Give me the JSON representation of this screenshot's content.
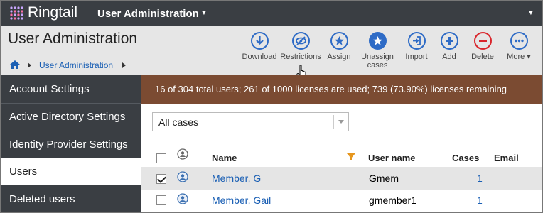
{
  "app": {
    "brand": "Ringtail",
    "module": "User Administration"
  },
  "header": {
    "title": "User Administration",
    "breadcrumb": [
      "User Administration"
    ]
  },
  "toolbar": [
    {
      "label": "Download",
      "icon": "download-icon"
    },
    {
      "label": "Restrictions",
      "icon": "eye-slash-icon"
    },
    {
      "label": "Assign",
      "icon": "star-icon"
    },
    {
      "label": "Unassign cases",
      "icon": "star-filled-icon"
    },
    {
      "label": "Import",
      "icon": "import-icon"
    },
    {
      "label": "Add",
      "icon": "plus-icon"
    },
    {
      "label": "Delete",
      "icon": "minus-icon"
    },
    {
      "label": "More",
      "icon": "more-icon"
    }
  ],
  "sidebar": {
    "items": [
      {
        "label": "Account Settings"
      },
      {
        "label": "Active Directory Settings"
      },
      {
        "label": "Identity Provider Settings"
      },
      {
        "label": "Users"
      },
      {
        "label": "Deleted users"
      }
    ]
  },
  "banner": {
    "text": "16 of 304 total users; 261 of 1000 licenses are used; 739 (73.90%) licenses remaining"
  },
  "filter": {
    "value": "All cases"
  },
  "table": {
    "headers": {
      "name": "Name",
      "username": "User name",
      "cases": "Cases",
      "email": "Email"
    },
    "rows": [
      {
        "name": "Member, G",
        "username": "Gmem",
        "cases": "1",
        "email": "",
        "checked": true
      },
      {
        "name": "Member, Gail",
        "username": "gmember1",
        "cases": "1",
        "email": "",
        "checked": false
      }
    ]
  },
  "colors": {
    "accent": "#2e6bc6",
    "banner": "#7b4b32",
    "sidebar": "#3a3e43",
    "delete": "#d9262c"
  }
}
